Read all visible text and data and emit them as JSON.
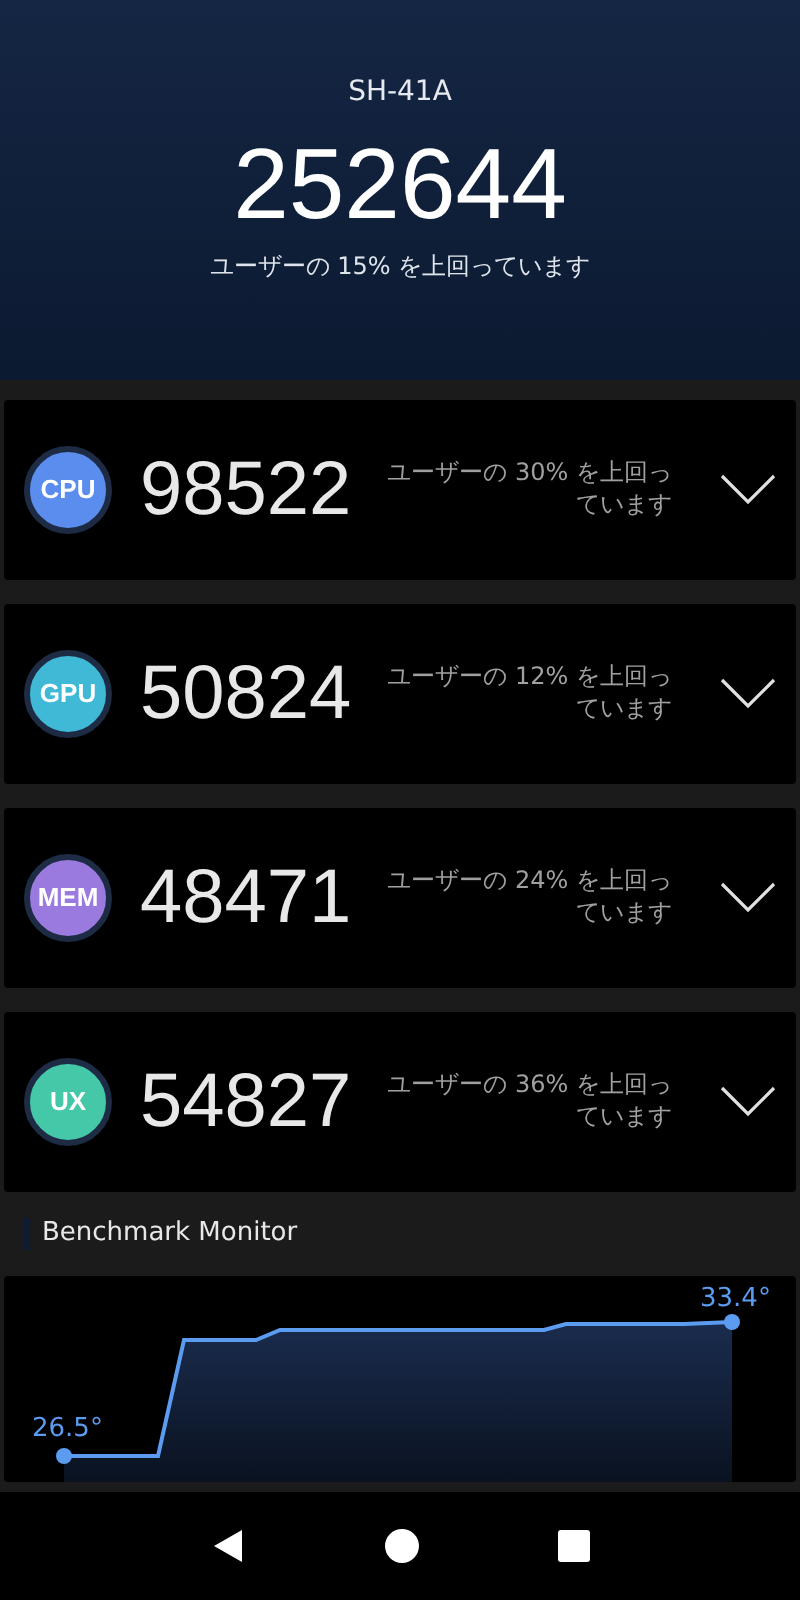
{
  "device": "SH-41A",
  "total_score": "252644",
  "total_rank": "ユーザーの 15% を上回っています",
  "scores": [
    {
      "label": "CPU",
      "color": "#5b8def",
      "score": "98522",
      "rank": "ユーザーの 30% を上回っています",
      "expanded": false
    },
    {
      "label": "GPU",
      "color": "#3fb9d6",
      "score": "50824",
      "rank": "ユーザーの 12% を上回っています",
      "expanded": false
    },
    {
      "label": "MEM",
      "color": "#9b7ae0",
      "score": "48471",
      "rank": "ユーザーの 24% を上回っています",
      "expanded": false
    },
    {
      "label": "UX",
      "color": "#44c8a8",
      "score": "54827",
      "rank": "ユーザーの 36% を上回っています",
      "expanded": false
    }
  ],
  "monitor": {
    "title": "Benchmark Monitor",
    "start_label": "26.5°",
    "end_label": "33.4°"
  }
}
